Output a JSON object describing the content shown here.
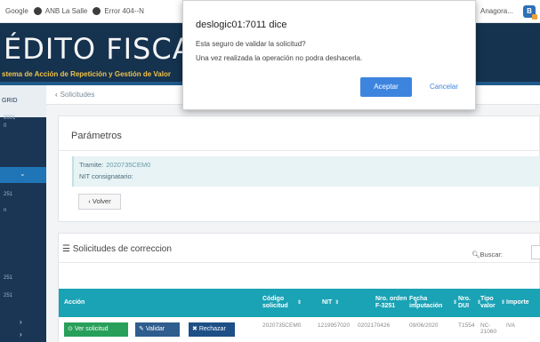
{
  "bookmarks": {
    "items": [
      {
        "label": "Google"
      },
      {
        "label": "ANB La Salle"
      },
      {
        "label": "Error 404--N"
      }
    ],
    "right_label": "Anagora..."
  },
  "banner": {
    "title": "ÉDITO FISCAL AD",
    "subtitle": "stema de Acción de Repetición y Gestión de Valor"
  },
  "sidebar": {
    "top_label": "GRID",
    "labels": [
      "2001",
      "0",
      "251",
      "n",
      "251",
      "251"
    ]
  },
  "breadcrumb": {
    "label": "Solicitudes"
  },
  "parametros": {
    "title": "Parámetros",
    "tramite_label": "Tramite:",
    "tramite_value": "2020735CEM0",
    "nit_label": "NIT consignatario:",
    "nit_value": "",
    "volver_label": "Volver"
  },
  "solicitudes": {
    "title": "Solicitudes de correccion",
    "buscar_label": "Buscar:",
    "columns": [
      {
        "label": "Acción"
      },
      {
        "label": "Código solicitud"
      },
      {
        "label": "NIT"
      },
      {
        "label": "Nro. orden F-3251"
      },
      {
        "label": "Fecha imputación"
      },
      {
        "label": "Nro. DUI"
      },
      {
        "label": "Tipo valor"
      },
      {
        "label": "Importe"
      }
    ],
    "row": {
      "ver_label": "Ver solicitud",
      "validar_label": "Validar",
      "rechazar_label": "Rechazar",
      "codigo": "2020735CEM0",
      "nit": "1219957020",
      "orden": "0202170426",
      "fecha": "09/06/2020",
      "dui": "T1554",
      "tipo": "NC-21060",
      "importe": "IVA"
    }
  },
  "dialog": {
    "title": "deslogic01:7011 dice",
    "message1": "Esta seguro de validar la solicitud?",
    "message2": "Una vez realizada la operación no podra deshacerla.",
    "accept_label": "Aceptar",
    "cancel_label": "Cancelar"
  },
  "colors": {
    "banner": "#15324f",
    "table_header": "#1aa2b5",
    "accept_button": "#3d84df",
    "ver_button": "#28a05a"
  }
}
